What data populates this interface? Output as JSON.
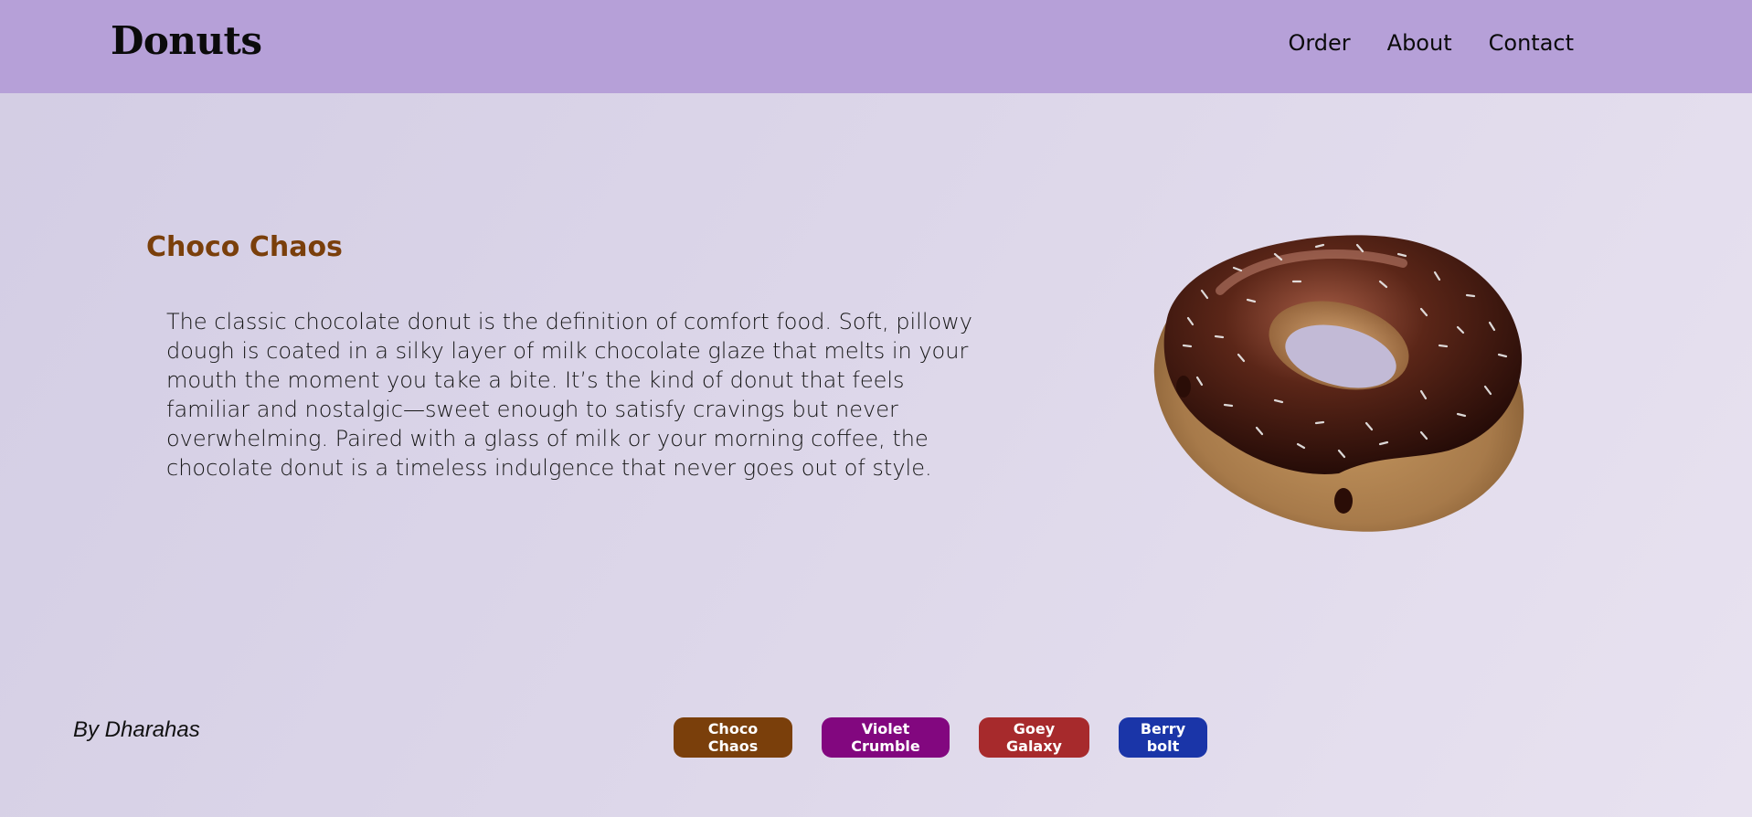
{
  "header": {
    "brand": "Donuts",
    "nav": [
      "Order",
      "About",
      "Contact"
    ]
  },
  "hero": {
    "title": "Choco Chaos",
    "title_color": "#7a3f0b",
    "description": "The classic chocolate donut is the definition of comfort food. Soft, pillowy dough is coated in a silky layer of milk chocolate glaze that melts in your mouth the moment you take a bite. It’s the kind of donut that feels familiar and nostalgic—sweet enough to satisfy cravings but never overwhelming. Paired with a glass of milk or your morning coffee, the chocolate donut is a timeless indulgence that never goes out of style.",
    "image": "chocolate-sprinkle-donut"
  },
  "footer": {
    "credit": "By Dharahas",
    "flavors": [
      {
        "label": "Choco Chaos",
        "color": "#7a3f0b"
      },
      {
        "label": "Violet Crumble",
        "color": "#82077f"
      },
      {
        "label": "Goey Galaxy",
        "color": "#a72a2c"
      },
      {
        "label": "Berry bolt",
        "color": "#1a35a8"
      }
    ]
  },
  "colors": {
    "header_bg": "#b6a0d8",
    "page_bg": "#dcd6e9"
  }
}
